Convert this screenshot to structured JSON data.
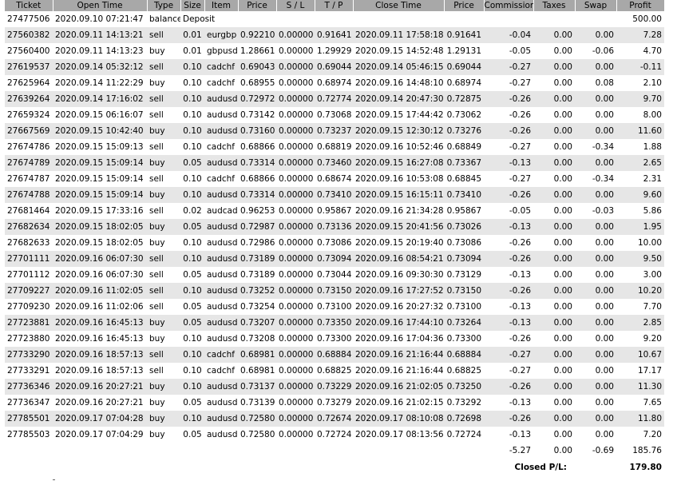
{
  "columns": [
    "Ticket",
    "Open Time",
    "Type",
    "Size",
    "Item",
    "Price",
    "S / L",
    "T / P",
    "Close Time",
    "Price",
    "Commission",
    "Taxes",
    "Swap",
    "Profit"
  ],
  "balance_row": {
    "ticket": "27477506",
    "open_time": "2020.09.10 07:21:47",
    "type": "balance",
    "comment": "Deposit",
    "profit": "500.00"
  },
  "trades": [
    [
      "27560382",
      "2020.09.11 14:13:21",
      "sell",
      "0.01",
      "eurgbp",
      "0.92210",
      "0.00000",
      "0.91641",
      "2020.09.11 17:58:18",
      "0.91641",
      "-0.04",
      "0.00",
      "0.00",
      "7.28"
    ],
    [
      "27560400",
      "2020.09.11 14:13:23",
      "buy",
      "0.01",
      "gbpusd",
      "1.28661",
      "0.00000",
      "1.29929",
      "2020.09.15 14:52:48",
      "1.29131",
      "-0.05",
      "0.00",
      "-0.06",
      "4.70"
    ],
    [
      "27619537",
      "2020.09.14 05:32:12",
      "sell",
      "0.10",
      "cadchf",
      "0.69043",
      "0.00000",
      "0.69044",
      "2020.09.14 05:46:15",
      "0.69044",
      "-0.27",
      "0.00",
      "0.00",
      "-0.11"
    ],
    [
      "27625964",
      "2020.09.14 11:22:29",
      "buy",
      "0.10",
      "cadchf",
      "0.68955",
      "0.00000",
      "0.68974",
      "2020.09.16 14:48:10",
      "0.68974",
      "-0.27",
      "0.00",
      "0.08",
      "2.10"
    ],
    [
      "27639264",
      "2020.09.14 17:16:02",
      "sell",
      "0.10",
      "audusd",
      "0.72972",
      "0.00000",
      "0.72774",
      "2020.09.14 20:47:30",
      "0.72875",
      "-0.26",
      "0.00",
      "0.00",
      "9.70"
    ],
    [
      "27659324",
      "2020.09.15 06:16:07",
      "sell",
      "0.10",
      "audusd",
      "0.73142",
      "0.00000",
      "0.73068",
      "2020.09.15 17:44:42",
      "0.73062",
      "-0.26",
      "0.00",
      "0.00",
      "8.00"
    ],
    [
      "27667569",
      "2020.09.15 10:42:40",
      "buy",
      "0.10",
      "audusd",
      "0.73160",
      "0.00000",
      "0.73237",
      "2020.09.15 12:30:12",
      "0.73276",
      "-0.26",
      "0.00",
      "0.00",
      "11.60"
    ],
    [
      "27674786",
      "2020.09.15 15:09:13",
      "sell",
      "0.10",
      "cadchf",
      "0.68866",
      "0.00000",
      "0.68819",
      "2020.09.16 10:52:46",
      "0.68849",
      "-0.27",
      "0.00",
      "-0.34",
      "1.88"
    ],
    [
      "27674789",
      "2020.09.15 15:09:14",
      "buy",
      "0.05",
      "audusd",
      "0.73314",
      "0.00000",
      "0.73460",
      "2020.09.15 16:27:08",
      "0.73367",
      "-0.13",
      "0.00",
      "0.00",
      "2.65"
    ],
    [
      "27674787",
      "2020.09.15 15:09:14",
      "sell",
      "0.10",
      "cadchf",
      "0.68866",
      "0.00000",
      "0.68674",
      "2020.09.16 10:53:08",
      "0.68845",
      "-0.27",
      "0.00",
      "-0.34",
      "2.31"
    ],
    [
      "27674788",
      "2020.09.15 15:09:14",
      "buy",
      "0.10",
      "audusd",
      "0.73314",
      "0.00000",
      "0.73410",
      "2020.09.15 16:15:11",
      "0.73410",
      "-0.26",
      "0.00",
      "0.00",
      "9.60"
    ],
    [
      "27681464",
      "2020.09.15 17:33:16",
      "sell",
      "0.02",
      "audcad",
      "0.96253",
      "0.00000",
      "0.95867",
      "2020.09.16 21:34:28",
      "0.95867",
      "-0.05",
      "0.00",
      "-0.03",
      "5.86"
    ],
    [
      "27682634",
      "2020.09.15 18:02:05",
      "buy",
      "0.05",
      "audusd",
      "0.72987",
      "0.00000",
      "0.73136",
      "2020.09.15 20:41:56",
      "0.73026",
      "-0.13",
      "0.00",
      "0.00",
      "1.95"
    ],
    [
      "27682633",
      "2020.09.15 18:02:05",
      "buy",
      "0.10",
      "audusd",
      "0.72986",
      "0.00000",
      "0.73086",
      "2020.09.15 20:19:40",
      "0.73086",
      "-0.26",
      "0.00",
      "0.00",
      "10.00"
    ],
    [
      "27701111",
      "2020.09.16 06:07:30",
      "sell",
      "0.10",
      "audusd",
      "0.73189",
      "0.00000",
      "0.73094",
      "2020.09.16 08:54:21",
      "0.73094",
      "-0.26",
      "0.00",
      "0.00",
      "9.50"
    ],
    [
      "27701112",
      "2020.09.16 06:07:30",
      "sell",
      "0.05",
      "audusd",
      "0.73189",
      "0.00000",
      "0.73044",
      "2020.09.16 09:30:30",
      "0.73129",
      "-0.13",
      "0.00",
      "0.00",
      "3.00"
    ],
    [
      "27709227",
      "2020.09.16 11:02:05",
      "sell",
      "0.10",
      "audusd",
      "0.73252",
      "0.00000",
      "0.73150",
      "2020.09.16 17:27:52",
      "0.73150",
      "-0.26",
      "0.00",
      "0.00",
      "10.20"
    ],
    [
      "27709230",
      "2020.09.16 11:02:06",
      "sell",
      "0.05",
      "audusd",
      "0.73254",
      "0.00000",
      "0.73100",
      "2020.09.16 20:27:32",
      "0.73100",
      "-0.13",
      "0.00",
      "0.00",
      "7.70"
    ],
    [
      "27723881",
      "2020.09.16 16:45:13",
      "buy",
      "0.05",
      "audusd",
      "0.73207",
      "0.00000",
      "0.73350",
      "2020.09.16 17:44:10",
      "0.73264",
      "-0.13",
      "0.00",
      "0.00",
      "2.85"
    ],
    [
      "27723880",
      "2020.09.16 16:45:13",
      "buy",
      "0.10",
      "audusd",
      "0.73208",
      "0.00000",
      "0.73300",
      "2020.09.16 17:04:36",
      "0.73300",
      "-0.26",
      "0.00",
      "0.00",
      "9.20"
    ],
    [
      "27733290",
      "2020.09.16 18:57:13",
      "sell",
      "0.10",
      "cadchf",
      "0.68981",
      "0.00000",
      "0.68884",
      "2020.09.16 21:16:44",
      "0.68884",
      "-0.27",
      "0.00",
      "0.00",
      "10.67"
    ],
    [
      "27733291",
      "2020.09.16 18:57:13",
      "sell",
      "0.10",
      "cadchf",
      "0.68981",
      "0.00000",
      "0.68825",
      "2020.09.16 21:16:44",
      "0.68825",
      "-0.27",
      "0.00",
      "0.00",
      "17.17"
    ],
    [
      "27736346",
      "2020.09.16 20:27:21",
      "buy",
      "0.10",
      "audusd",
      "0.73137",
      "0.00000",
      "0.73229",
      "2020.09.16 21:02:05",
      "0.73250",
      "-0.26",
      "0.00",
      "0.00",
      "11.30"
    ],
    [
      "27736347",
      "2020.09.16 20:27:21",
      "buy",
      "0.05",
      "audusd",
      "0.73139",
      "0.00000",
      "0.73279",
      "2020.09.16 21:02:15",
      "0.73292",
      "-0.13",
      "0.00",
      "0.00",
      "7.65"
    ],
    [
      "27785501",
      "2020.09.17 07:04:28",
      "buy",
      "0.10",
      "audusd",
      "0.72580",
      "0.00000",
      "0.72674",
      "2020.09.17 08:10:08",
      "0.72698",
      "-0.26",
      "0.00",
      "0.00",
      "11.80"
    ],
    [
      "27785503",
      "2020.09.17 07:04:29",
      "buy",
      "0.05",
      "audusd",
      "0.72580",
      "0.00000",
      "0.72724",
      "2020.09.17 08:13:56",
      "0.72724",
      "-0.13",
      "0.00",
      "0.00",
      "7.20"
    ]
  ],
  "totals": {
    "commission": "-5.27",
    "taxes": "0.00",
    "swap": "-0.69",
    "profit": "185.76"
  },
  "closed_pl": {
    "label": "Closed P/L:",
    "value": "179.80"
  },
  "colors": {
    "header_bg": "#a8a8a8",
    "stripe_bg": "#e6e6e6"
  }
}
